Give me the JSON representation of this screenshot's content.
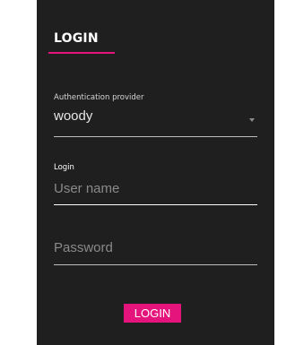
{
  "tab": {
    "label": "LOGIN"
  },
  "provider": {
    "label": "Authentication provider",
    "value": "woody",
    "icon": "caret-down-icon"
  },
  "login": {
    "label": "Login",
    "placeholder": "User name",
    "value": ""
  },
  "password": {
    "placeholder": "Password",
    "value": ""
  },
  "submit": {
    "label": "LOGIN"
  },
  "colors": {
    "accent": "#e5147d",
    "panel": "#1f1f1f"
  }
}
